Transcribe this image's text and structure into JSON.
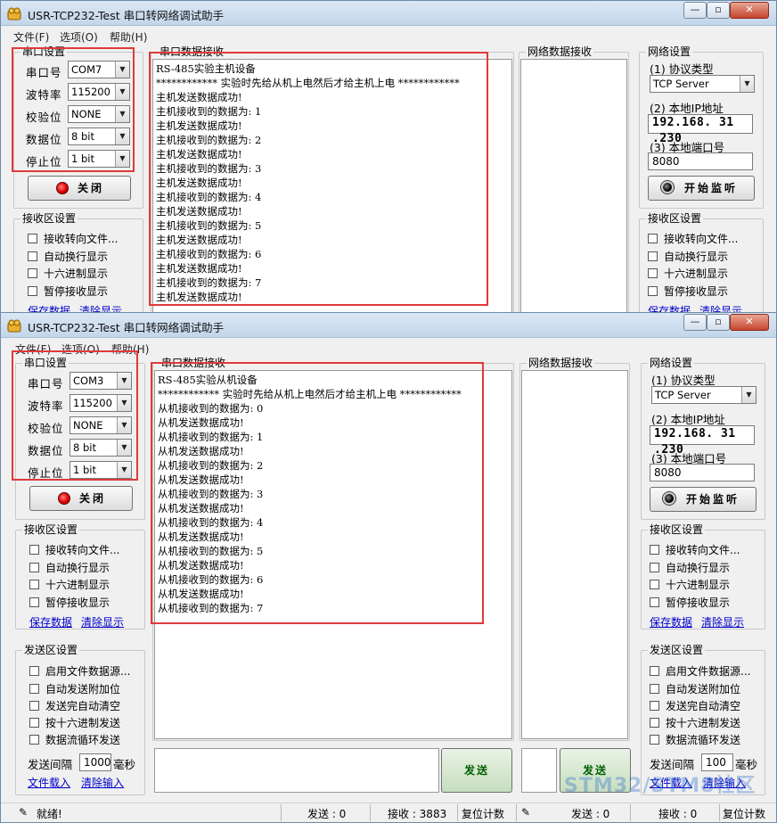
{
  "top": {
    "title": "USR-TCP232-Test 串口转网络调试助手",
    "window_buttons": {
      "min": "—",
      "max": "▫",
      "close": "✕"
    },
    "menu": [
      "文件(F)",
      "选项(O)",
      "帮助(H)"
    ],
    "serial_settings": {
      "title": "串口设置",
      "fields": [
        {
          "label": "串口号",
          "value": "COM7"
        },
        {
          "label": "波特率",
          "value": "115200"
        },
        {
          "label": "校验位",
          "value": "NONE"
        },
        {
          "label": "数据位",
          "value": "8 bit"
        },
        {
          "label": "停止位",
          "value": "1 bit"
        }
      ],
      "close_button": "关闭"
    },
    "recv_settings": {
      "title": "接收区设置",
      "options": [
        "接收转向文件...",
        "自动换行显示",
        "十六进制显示",
        "暂停接收显示"
      ],
      "save_link": "保存数据",
      "clear_link": "清除显示"
    },
    "serial_recv": {
      "title": "串口数据接收",
      "lines": [
        "RS-485实验主机设备",
        "************ 实验时先给从机上电然后才给主机上电 ************",
        "主机发送数据成功!",
        "主机接收到的数据为: 1",
        "主机发送数据成功!",
        "主机接收到的数据为: 2",
        "主机发送数据成功!",
        "主机接收到的数据为: 3",
        "主机发送数据成功!",
        "主机接收到的数据为: 4",
        "主机发送数据成功!",
        "主机接收到的数据为: 5",
        "主机发送数据成功!",
        "主机接收到的数据为: 6",
        "主机发送数据成功!",
        "主机接收到的数据为: 7",
        "主机发送数据成功!"
      ]
    },
    "net_recv": {
      "title": "网络数据接收"
    },
    "net_settings": {
      "title": "网络设置",
      "protocol_label": "(1) 协议类型",
      "protocol_value": "TCP Server",
      "ip_label": "(2) 本地IP地址",
      "ip_value": "192.168. 31 .230",
      "port_label": "(3) 本地端口号",
      "port_value": "8080",
      "listen_button": "开始监听"
    },
    "net_recv_settings": {
      "title": "接收区设置",
      "options": [
        "接收转向文件...",
        "自动换行显示",
        "十六进制显示",
        "暂停接收显示"
      ],
      "save_link": "保存数据",
      "clear_link": "清除显示"
    }
  },
  "bottom": {
    "title": "USR-TCP232-Test 串口转网络调试助手",
    "window_buttons": {
      "min": "—",
      "max": "▫",
      "close": "✕"
    },
    "menu": [
      "文件(F)",
      "选项(O)",
      "帮助(H)"
    ],
    "serial_settings": {
      "title": "串口设置",
      "fields": [
        {
          "label": "串口号",
          "value": "COM3"
        },
        {
          "label": "波特率",
          "value": "115200"
        },
        {
          "label": "校验位",
          "value": "NONE"
        },
        {
          "label": "数据位",
          "value": "8 bit"
        },
        {
          "label": "停止位",
          "value": "1 bit"
        }
      ],
      "close_button": "关闭"
    },
    "recv_settings": {
      "title": "接收区设置",
      "options": [
        "接收转向文件...",
        "自动换行显示",
        "十六进制显示",
        "暂停接收显示"
      ],
      "save_link": "保存数据",
      "clear_link": "清除显示"
    },
    "send_settings": {
      "title": "发送区设置",
      "options": [
        "启用文件数据源...",
        "自动发送附加位",
        "发送完自动清空",
        "按十六进制发送",
        "数据流循环发送"
      ],
      "interval_label": "发送间隔",
      "interval_value": "1000",
      "interval_unit": "毫秒",
      "load_link": "文件载入",
      "clear_link": "清除输入"
    },
    "serial_recv": {
      "title": "串口数据接收",
      "lines": [
        "RS-485实验从机设备",
        "************ 实验时先给从机上电然后才给主机上电 ************",
        "从机接收到的数据为: 0",
        "从机发送数据成功!",
        "从机接收到的数据为: 1",
        "从机发送数据成功!",
        "从机接收到的数据为: 2",
        "从机发送数据成功!",
        "从机接收到的数据为: 3",
        "从机发送数据成功!",
        "从机接收到的数据为: 4",
        "从机发送数据成功!",
        "从机接收到的数据为: 5",
        "从机发送数据成功!",
        "从机接收到的数据为: 6",
        "从机发送数据成功!",
        "从机接收到的数据为: 7"
      ]
    },
    "send_button": "发送",
    "net_recv": {
      "title": "网络数据接收"
    },
    "net_send_button": "发送",
    "net_settings": {
      "title": "网络设置",
      "protocol_label": "(1) 协议类型",
      "protocol_value": "TCP Server",
      "ip_label": "(2) 本地IP地址",
      "ip_value": "192.168. 31 .230",
      "port_label": "(3) 本地端口号",
      "port_value": "8080",
      "listen_button": "开始监听"
    },
    "net_recv_settings": {
      "title": "接收区设置",
      "options": [
        "接收转向文件...",
        "自动换行显示",
        "十六进制显示",
        "暂停接收显示"
      ],
      "save_link": "保存数据",
      "clear_link": "清除显示"
    },
    "net_send_settings": {
      "title": "发送区设置",
      "options": [
        "启用文件数据源...",
        "自动发送附加位",
        "发送完自动清空",
        "按十六进制发送",
        "数据流循环发送"
      ],
      "interval_label": "发送间隔",
      "interval_value": "100",
      "interval_unit": "毫秒",
      "load_link": "文件载入",
      "clear_link": "清除输入"
    },
    "status": {
      "ready": "就绪!",
      "send_label": "发送 : 0",
      "recv_label": "接收 : 3883",
      "reset_label": "复位计数",
      "net_send_label": "发送 : 0",
      "net_recv_label": "接收 : 0",
      "net_reset_label": "复位计数"
    }
  },
  "watermark": "STM32/STM8社区",
  "colors": {
    "highlight_box": "#e03a3a",
    "link": "#0000cc",
    "title_gradient": "#c3d6ea"
  }
}
